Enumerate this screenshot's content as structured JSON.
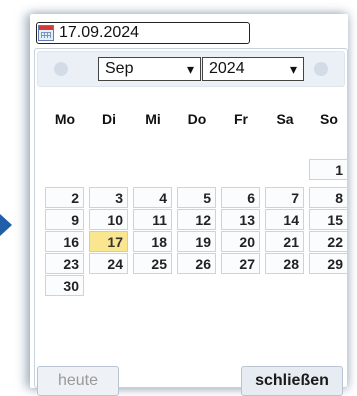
{
  "date_input": {
    "value": "17.09.2024"
  },
  "calendar": {
    "month": "Sep",
    "year": "2024",
    "weekdays": [
      "Mo",
      "Di",
      "Mi",
      "Do",
      "Fr",
      "Sa",
      "So"
    ],
    "days": [
      "1",
      "2",
      "3",
      "4",
      "5",
      "6",
      "7",
      "8",
      "9",
      "10",
      "11",
      "12",
      "13",
      "14",
      "15",
      "16",
      "17",
      "18",
      "19",
      "20",
      "21",
      "22",
      "23",
      "24",
      "25",
      "26",
      "27",
      "28",
      "29",
      "30"
    ],
    "selected_day": "17"
  },
  "buttons": {
    "today": "heute",
    "close": "schließen"
  },
  "icons": {
    "calendar": "calendar-icon",
    "prev": "circle-left-icon",
    "next": "circle-right-icon"
  },
  "colors": {
    "selected_bg": "#f9e68e",
    "border": "#c9d4e0",
    "header_bg": "#eaf0f6"
  }
}
